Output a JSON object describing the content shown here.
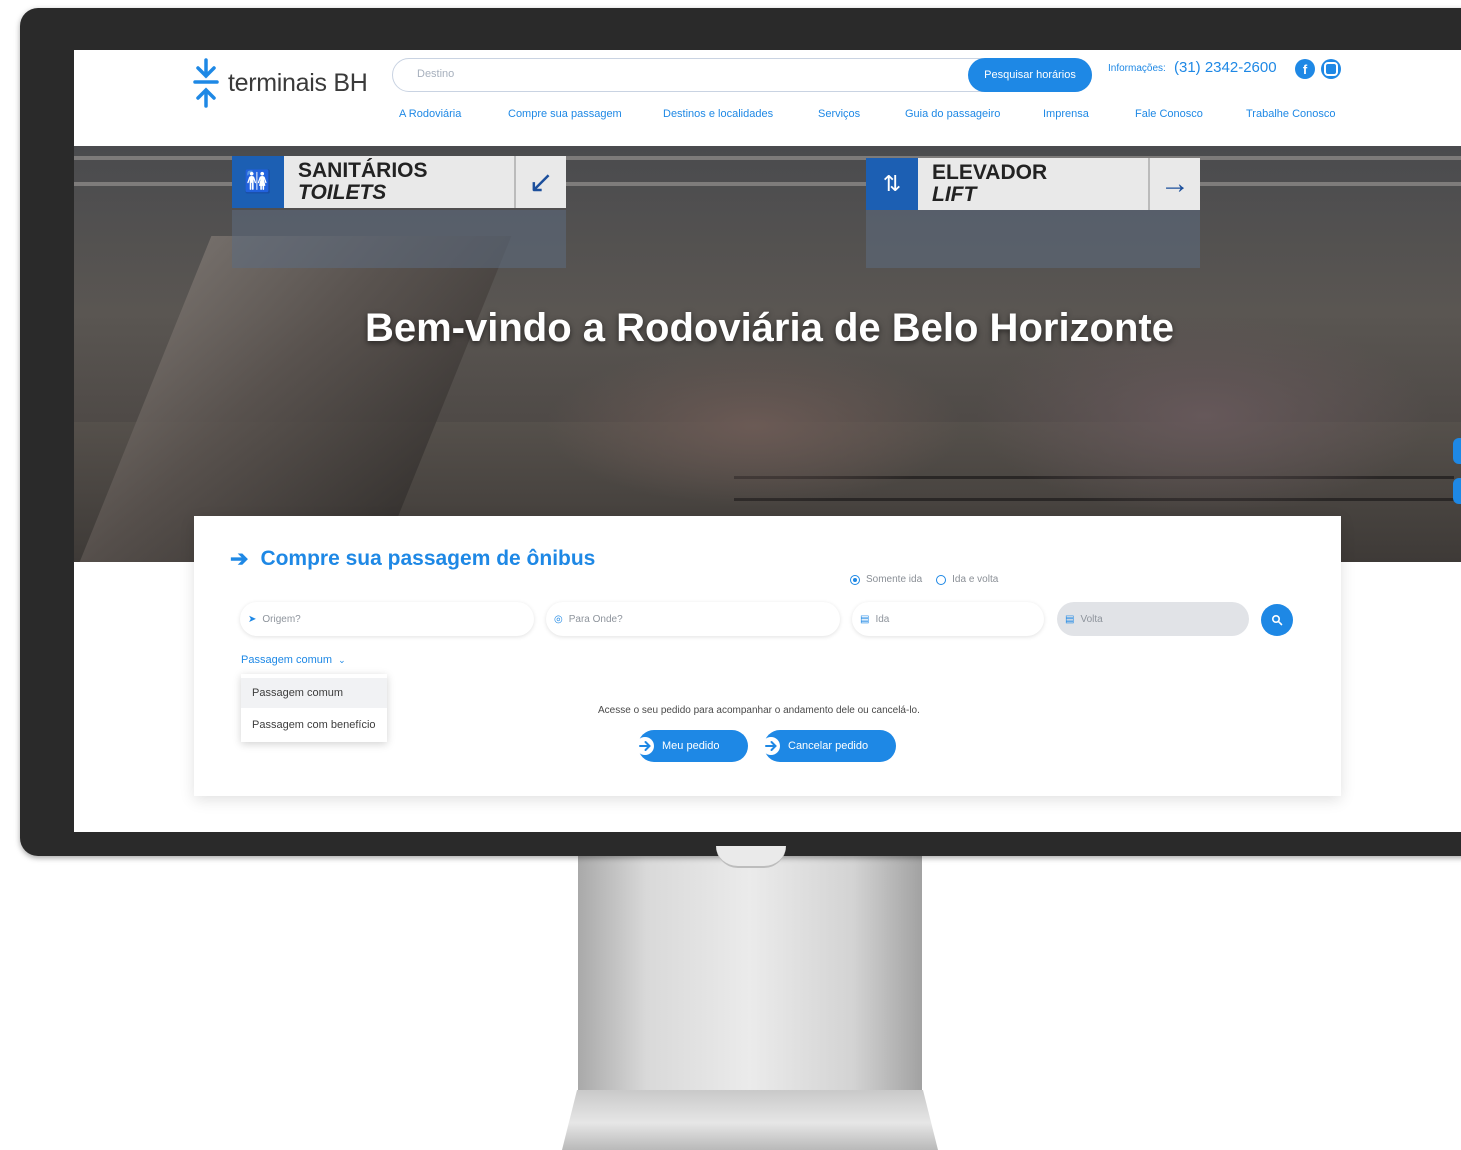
{
  "header": {
    "logo_text": "terminais BH",
    "search_placeholder": "Destino",
    "search_button": "Pesquisar horários",
    "info_label": "Informações:",
    "info_phone": "(31) 2342-2600",
    "social": [
      "facebook-icon",
      "instagram-icon"
    ]
  },
  "nav": [
    "A Rodoviária",
    "Compre sua passagem",
    "Destinos e localidades",
    "Serviços",
    "Guia do passageiro",
    "Imprensa",
    "Fale Conosco",
    "Trabalhe Conosco"
  ],
  "hero": {
    "title": "Bem-vindo a Rodoviária de Belo Horizonte",
    "sign_left": {
      "line1": "SANITÁRIOS",
      "line2": "TOILETS"
    },
    "sign_right": {
      "line1": "ELEVADOR",
      "line2": "LIFT"
    }
  },
  "booking": {
    "title": "Compre sua passagem de ônibus",
    "trip_options": [
      "Somente ida",
      "Ida e volta"
    ],
    "selected_trip": "Somente ida",
    "origin_placeholder": "Origem?",
    "destination_placeholder": "Para Onde?",
    "departure_placeholder": "Ida",
    "return_placeholder": "Volta",
    "ticket_type_selected": "Passagem comum",
    "ticket_type_options": [
      "Passagem comum",
      "Passagem com benefício"
    ],
    "order_text": "Acesse o seu pedido para acompanhar o andamento dele ou cancelá-lo.",
    "my_order_button": "Meu pedido",
    "cancel_order_button": "Cancelar pedido"
  },
  "colors": {
    "accent": "#1e88e5",
    "sign_blue": "#1c5fb3"
  }
}
